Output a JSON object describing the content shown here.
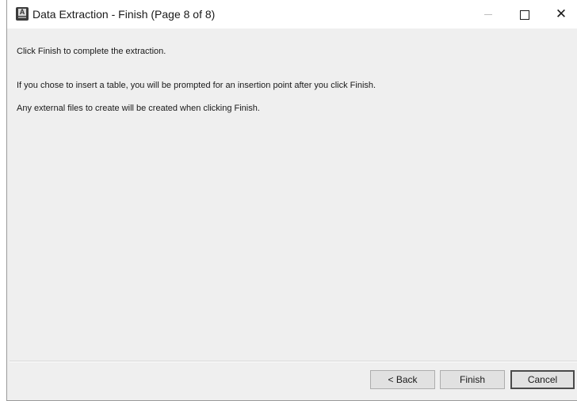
{
  "window": {
    "title": "Data Extraction - Finish (Page 8 of 8)",
    "app_icon": "autocad-icon",
    "controls": {
      "minimize": "minimize-icon",
      "maximize": "maximize-icon",
      "close": "close-icon",
      "close_glyph": "✕"
    }
  },
  "content": {
    "line1": "Click Finish to complete the extraction.",
    "line2": "If you chose to insert a table, you will be prompted for an insertion point after you click Finish.",
    "line3": "Any external files to create will be created when clicking Finish."
  },
  "buttons": {
    "back": "< Back",
    "finish": "Finish",
    "cancel": "Cancel"
  }
}
